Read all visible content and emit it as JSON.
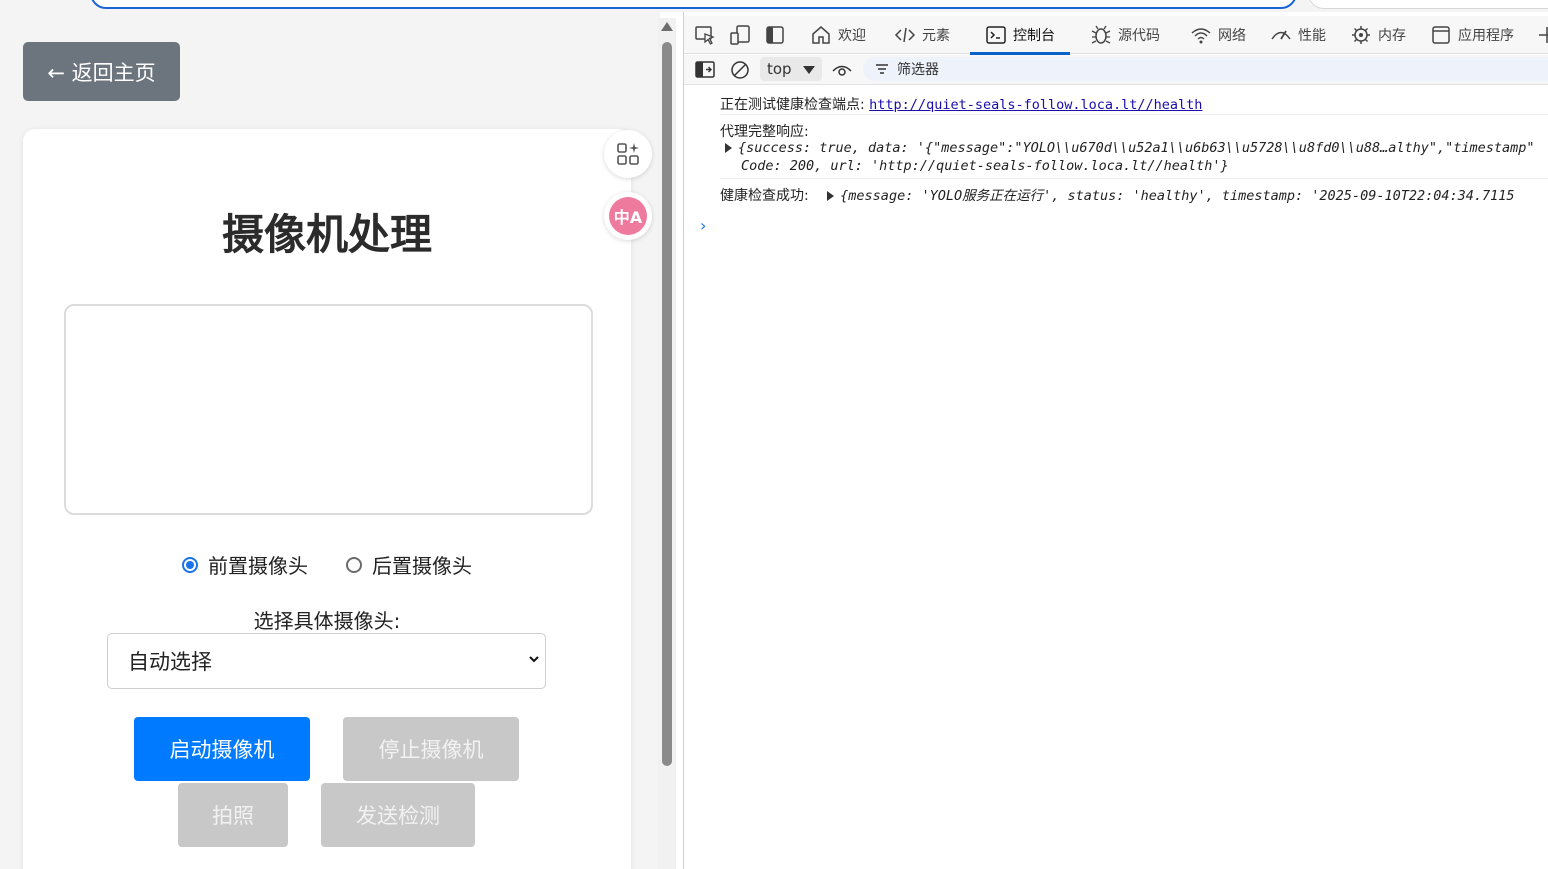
{
  "page": {
    "back_label": "← 返回主页",
    "title": "摄像机处理",
    "camera_options": [
      {
        "label": "前置摄像头",
        "checked": true
      },
      {
        "label": "后置摄像头",
        "checked": false
      }
    ],
    "select_label": "选择具体摄像头:",
    "select_value": "自动选择",
    "buttons": {
      "start": "启动摄像机",
      "stop": "停止摄像机",
      "photo": "拍照",
      "send": "发送检测"
    },
    "floating_icons": [
      "apps-sparkle-icon",
      "translate-icon"
    ],
    "translate_glyph": "中A"
  },
  "devtools": {
    "tabs": [
      {
        "label": "欢迎",
        "icon": "home-icon"
      },
      {
        "label": "元素",
        "icon": "code-icon"
      },
      {
        "label": "控制台",
        "icon": "console-icon",
        "active": true
      },
      {
        "label": "源代码",
        "icon": "bug-icon"
      },
      {
        "label": "网络",
        "icon": "wifi-icon"
      },
      {
        "label": "性能",
        "icon": "gauge-icon"
      },
      {
        "label": "内存",
        "icon": "chip-icon"
      },
      {
        "label": "应用程序",
        "icon": "app-window-icon"
      }
    ],
    "context": "top",
    "filter_label": "筛选器",
    "console": {
      "line1_prefix": "正在测试健康检查端点:",
      "line1_url": "http://quiet-seals-follow.loca.lt//health",
      "line2": "代理完整响应:",
      "line3_obj_a": "{success: true, data: '{\"message\":\"YOLO\\\\u670d\\\\u52a1\\\\u6b63\\\\u5728\\\\u8fd0\\\\u88…althy\",\"timestamp\"",
      "line3_obj_b": "Code: 200, url: 'http://quiet-seals-follow.loca.lt//health'}",
      "line4_prefix": "健康检查成功:",
      "line4_obj": "{message: 'YOLO服务正在运行', status: 'healthy', timestamp: '2025-09-10T22:04:34.7115"
    }
  },
  "colors": {
    "primary": "#007bff",
    "disabled": "#c8c8c8",
    "back_button": "#6c757d",
    "devtools_active": "#0a63c9"
  }
}
